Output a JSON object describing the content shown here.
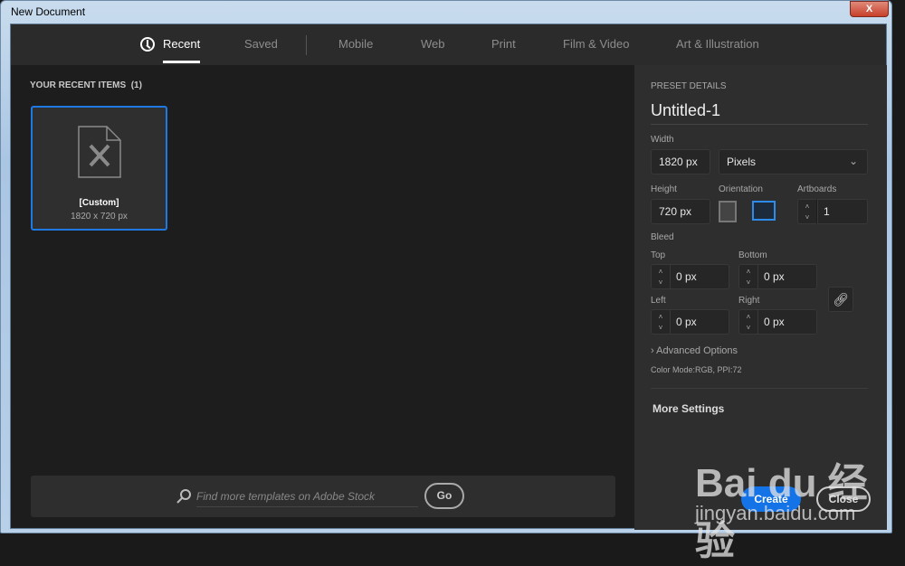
{
  "window": {
    "title": "New Document",
    "close_glyph": "X"
  },
  "tabs": [
    {
      "label": "Recent",
      "icon": "clock-icon",
      "active": true
    },
    {
      "label": "Saved"
    },
    {
      "label": "Mobile"
    },
    {
      "label": "Web"
    },
    {
      "label": "Print"
    },
    {
      "label": "Film & Video"
    },
    {
      "label": "Art & Illustration"
    }
  ],
  "recent": {
    "header": "YOUR RECENT ITEMS",
    "count": "(1)",
    "items": [
      {
        "name": "[Custom]",
        "size": "1820 x 720 px"
      }
    ]
  },
  "stock": {
    "placeholder": "Find more templates on Adobe Stock",
    "go": "Go"
  },
  "preset": {
    "header": "PRESET DETAILS",
    "name": "Untitled-1",
    "width_label": "Width",
    "width": "1820 px",
    "units": "Pixels",
    "height_label": "Height",
    "height": "720 px",
    "orientation_label": "Orientation",
    "orientation": "landscape",
    "artboards_label": "Artboards",
    "artboards": "1",
    "bleed_label": "Bleed",
    "top_label": "Top",
    "top": "0 px",
    "bottom_label": "Bottom",
    "bottom": "0 px",
    "left_label": "Left",
    "left": "0 px",
    "right_label": "Right",
    "right": "0 px",
    "advanced": "Advanced Options",
    "color_mode": "Color Mode:RGB, PPI:72",
    "more": "More Settings",
    "create": "Create",
    "close": "Close"
  },
  "colors": {
    "accent": "#1f79e3"
  },
  "watermark": {
    "text": "Bai du 经验",
    "url": "jingyan.baidu.com"
  }
}
